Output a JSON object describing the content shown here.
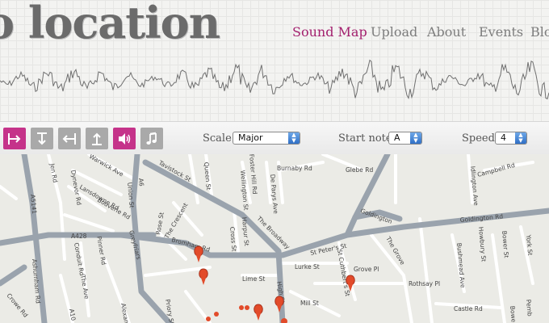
{
  "site": {
    "title": "o location"
  },
  "nav": {
    "items": [
      "Sound Map",
      "Upload",
      "About",
      "Events",
      "Blo"
    ],
    "active": 0
  },
  "toolbar": {
    "buttons": [
      {
        "icon": "align-left-right-icon",
        "active": true
      },
      {
        "icon": "align-vertical-icon",
        "active": false
      },
      {
        "icon": "align-right-icon",
        "active": false
      },
      {
        "icon": "align-top-icon",
        "active": false
      },
      {
        "icon": "speaker-icon",
        "active": true
      },
      {
        "icon": "music-note-icon",
        "active": false
      }
    ],
    "scale": {
      "label": "Scale:",
      "value": "Major"
    },
    "start_note": {
      "label": "Start note:",
      "value": "A"
    },
    "speed": {
      "label": "Speed:",
      "value": "4"
    }
  },
  "map": {
    "street_labels": [
      "Jen Rd",
      "Warwick Ave",
      "Dynevor Rd",
      "Lansdowne Rd",
      "Bouverie Rd",
      "A5141",
      "Ashurnham Rd",
      "Conduit Rd",
      "Pinner Rd",
      "The Ave",
      "Crowe Rd",
      "Alexandr",
      "A10",
      "Union St",
      "A6",
      "Rose St",
      "The Crescent",
      "Greyfriars",
      "Tavistock St",
      "Queen St",
      "Foster Hill Rd",
      "Wellington St",
      "De Parys Ave",
      "Burnaby Rd",
      "Glebe Rd",
      "The Broadway",
      "Harpur St",
      "Cross St",
      "Bromham Rd",
      "A428",
      "St Peter's St",
      "Goldington Rd",
      "Goldington",
      "Lime St",
      "Lurke St",
      "St Cuthbert's St",
      "Grove Pl",
      "The Grove",
      "Rothsay Pl",
      "Mill St",
      "High St",
      "Castle Rd",
      "Priory St",
      "Idlington Ave",
      "Campbell Rd",
      "Howbury St",
      "Bower St",
      "York St",
      "Bushmead Ave",
      "Pemb",
      "Bowe"
    ],
    "colors": {
      "roads": "#9aa3ad",
      "minor_roads": "#ffffff",
      "background": "#ebebe6",
      "markers": "#e24b2a"
    }
  }
}
